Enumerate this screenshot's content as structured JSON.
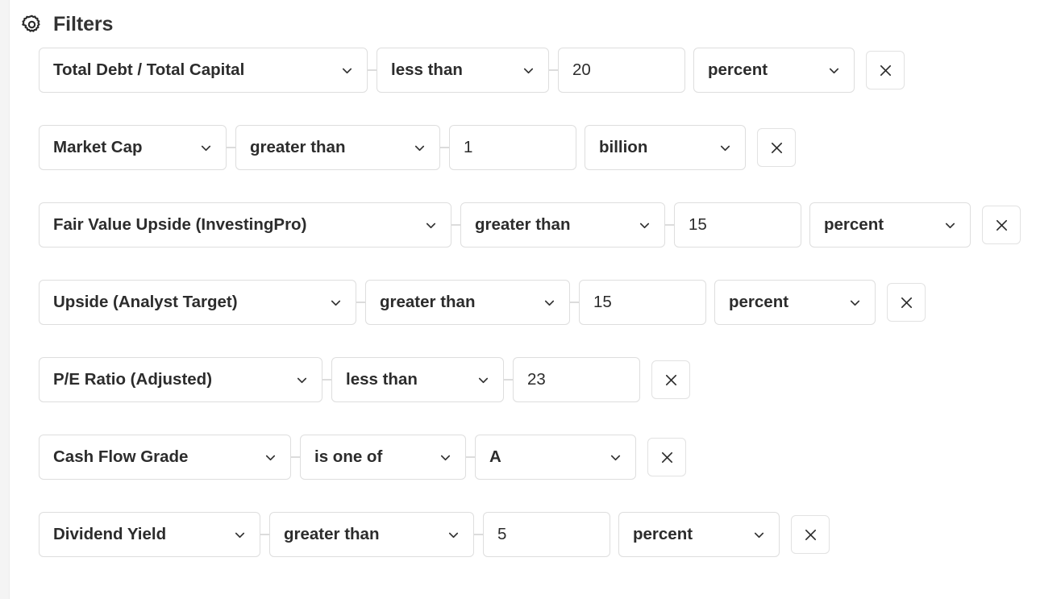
{
  "header": {
    "title": "Filters",
    "icon": "gear-icon"
  },
  "icons": {
    "chevron": "chevron-down-icon",
    "remove": "close-icon"
  },
  "filters": [
    {
      "metric": "Total Debt / Total Capital",
      "operator": "less than",
      "value": "20",
      "unit": "percent",
      "remove_label": "×",
      "metric_width": 408,
      "operator_width": 214,
      "value_width": 158,
      "unit_width": 200
    },
    {
      "metric": "Market Cap",
      "operator": "greater than",
      "value": "1",
      "unit": "billion",
      "remove_label": "×",
      "metric_width": 233,
      "operator_width": 254,
      "value_width": 158,
      "unit_width": 200
    },
    {
      "metric": "Fair Value Upside (InvestingPro)",
      "operator": "greater than",
      "value": "15",
      "unit": "percent",
      "remove_label": "×",
      "metric_width": 512,
      "operator_width": 254,
      "value_width": 158,
      "unit_width": 200
    },
    {
      "metric": "Upside (Analyst Target)",
      "operator": "greater than",
      "value": "15",
      "unit": "percent",
      "remove_label": "×",
      "metric_width": 394,
      "operator_width": 254,
      "value_width": 158,
      "unit_width": 200
    },
    {
      "metric": "P/E Ratio (Adjusted)",
      "operator": "less than",
      "value": "23",
      "unit": null,
      "remove_label": "×",
      "metric_width": 352,
      "operator_width": 214,
      "value_width": 158,
      "unit_width": 0
    },
    {
      "metric": "Cash Flow Grade",
      "operator": "is one of",
      "value": "A",
      "value_is_select": true,
      "unit": null,
      "remove_label": "×",
      "metric_width": 313,
      "operator_width": 206,
      "value_width": 200,
      "unit_width": 0
    },
    {
      "metric": "Dividend Yield",
      "operator": "greater than",
      "value": "5",
      "unit": "percent",
      "remove_label": "×",
      "metric_width": 275,
      "operator_width": 254,
      "value_width": 158,
      "unit_width": 200
    }
  ],
  "colors": {
    "border": "#dedede",
    "text": "#2c2c2c",
    "title": "#333333",
    "rail": "#f4f4f4"
  }
}
